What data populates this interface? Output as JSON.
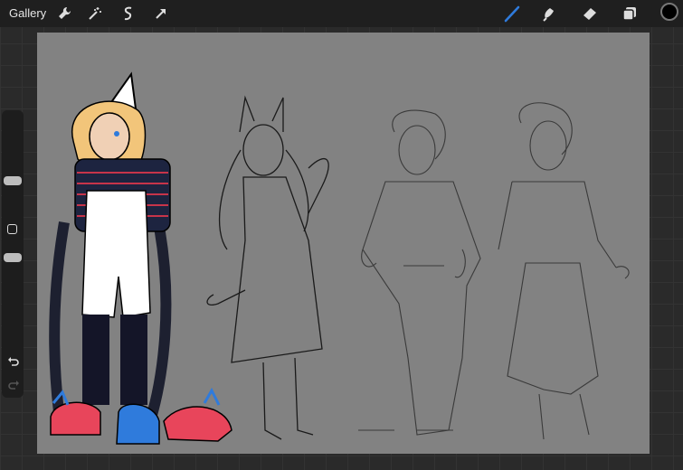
{
  "topbar": {
    "gallery_label": "Gallery",
    "left_tools": [
      "wrench-icon",
      "magic-wand-icon",
      "selection-icon",
      "transform-icon"
    ],
    "right_tools": [
      "brush-icon",
      "smudge-icon",
      "eraser-icon",
      "layers-icon"
    ],
    "active_tool": "brush",
    "current_color": "#000000"
  },
  "sidebar": {
    "controls": [
      "brush-size-slider",
      "modify-button",
      "opacity-slider",
      "undo-icon",
      "redo-icon"
    ]
  },
  "colors": {
    "canvas": "#828282",
    "accent": "#2f7bdc"
  }
}
